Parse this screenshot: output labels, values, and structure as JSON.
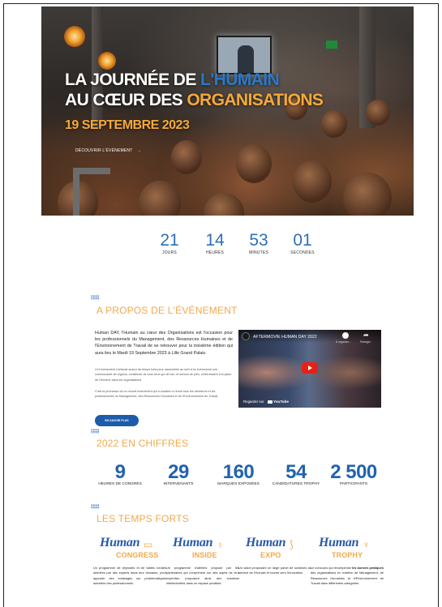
{
  "hero": {
    "title_line1_a": "LA JOURNÉE DE ",
    "title_line1_b": "L'HUMAIN",
    "title_line2_a": "AU CŒUR DES ",
    "title_line2_b": "ORGANISATIONS",
    "date": "19 SEPTEMBRE 2023",
    "discover_label": "DÉCOUVRIR L'ÉVÉNEMENT",
    "discover_arrow": "→"
  },
  "countdown": [
    {
      "value": "21",
      "label": "JOURS"
    },
    {
      "value": "14",
      "label": "HEURES"
    },
    {
      "value": "53",
      "label": "MINUTES"
    },
    {
      "value": "01",
      "label": "SECONDES"
    }
  ],
  "about": {
    "title": "A PROPOS DE L'ÉVÉNEMENT",
    "lead": "Human DAY, l'Humain au cœur des Organisations est l'occasion pour les professionnels du Management, des Ressources Humaines et de l'Environnement de Travail de se retrouver pour la troisième édition qui aura lieu le Mardi 19 Septembre 2023 à Lille Grand Palais.",
    "p1": "Cet évènement s'articule autour de temps forts pour rassembler au sein d'un évènement une communauté de régions, constituée de tous ceux qui de loin, et surtout de près, s'intéressent à la place de l'Homme dans les organisations.",
    "p2": "C'est la promesse de ce nouvel évènement qui a vocation à réunir tous les décideurs et les professionnels du Management, des Ressources Humaines et de l'Environnement de Travail.",
    "button": "EN SAVOIR PLUS",
    "video": {
      "title": "AFTERMOVIE HUMAN DAY 2022",
      "later": "À regarder...",
      "share": "Partager",
      "watch_on": "Regarder sur",
      "youtube": "YouTube"
    }
  },
  "figures": {
    "title": "2022 EN CHIFFRES",
    "items": [
      {
        "value": "9",
        "label": "HEURES DE CONGRÈS"
      },
      {
        "value": "29",
        "label": "INTERVENANTS"
      },
      {
        "value": "160",
        "label": "MARQUES EXPOSÉES"
      },
      {
        "value": "54",
        "label": "CANDIDATURES TROPHY"
      },
      {
        "value": "2 500",
        "label": "PARTICIPANTS"
      }
    ]
  },
  "highlights": {
    "title": "LES TEMPS FORTS",
    "items": [
      {
        "brand": "Human",
        "sub": "CONGRESS",
        "text": "Un programme de keynotes et de tables rondes animées par des experts dans leur domaine, pour apporter des éclairages sur problématiques actuelles des professionnels."
      },
      {
        "brand": "Human",
        "sub": "INSIDE",
        "text": "Un programme d'ateliers proposé par les partenaires qui s'expriment sur des sujets de leur expertise, proposant ainsi des solutions intellectuelles dans un espace privatisé."
      },
      {
        "brand": "Human",
        "sub": "EXPO",
        "text": "Un salon proposant un large panel de solutions au service de l'Humain et tourné vers l'innovation."
      },
      {
        "brand": "Human",
        "sub": "TROPHY",
        "text_a": "Le concours qui récompense ",
        "text_b": "les bonnes pratiques",
        "text_c": " des organisations en matière de Management, de Ressources Humaines et d'Environnement de Travail dans différentes catégories."
      }
    ]
  }
}
